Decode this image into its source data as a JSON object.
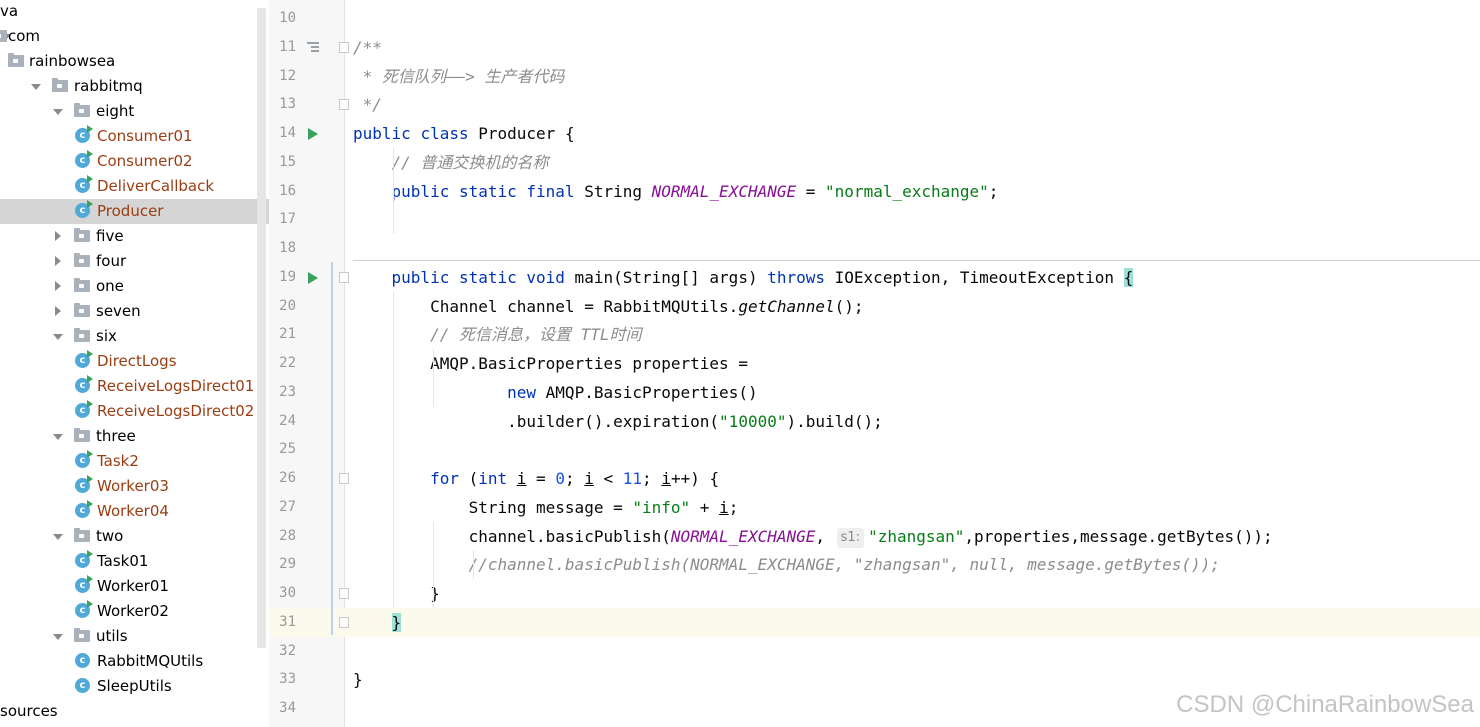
{
  "tree": {
    "items": [
      {
        "label": "va",
        "depth": 0,
        "kind": "text",
        "expanded": null,
        "modified": false
      },
      {
        "label": "com",
        "depth": 0,
        "kind": "package",
        "expanded": true,
        "modified": false
      },
      {
        "label": "rainbowsea",
        "depth": 0,
        "kind": "package",
        "expanded": null,
        "modified": false
      },
      {
        "label": "rabbitmq",
        "depth": 1,
        "kind": "package",
        "expanded": true,
        "modified": false
      },
      {
        "label": "eight",
        "depth": 2,
        "kind": "package",
        "expanded": true,
        "modified": false
      },
      {
        "label": "Consumer01",
        "depth": 3,
        "kind": "class",
        "expanded": null,
        "modified": true
      },
      {
        "label": "Consumer02",
        "depth": 3,
        "kind": "class",
        "expanded": null,
        "modified": true
      },
      {
        "label": "DeliverCallback",
        "depth": 3,
        "kind": "class",
        "expanded": null,
        "modified": true
      },
      {
        "label": "Producer",
        "depth": 3,
        "kind": "class",
        "expanded": null,
        "modified": true,
        "selected": true
      },
      {
        "label": "five",
        "depth": 2,
        "kind": "package",
        "expanded": false,
        "modified": false
      },
      {
        "label": "four",
        "depth": 2,
        "kind": "package",
        "expanded": false,
        "modified": false
      },
      {
        "label": "one",
        "depth": 2,
        "kind": "package",
        "expanded": false,
        "modified": false
      },
      {
        "label": "seven",
        "depth": 2,
        "kind": "package",
        "expanded": false,
        "modified": false
      },
      {
        "label": "six",
        "depth": 2,
        "kind": "package",
        "expanded": true,
        "modified": false
      },
      {
        "label": "DirectLogs",
        "depth": 3,
        "kind": "class",
        "expanded": null,
        "modified": true
      },
      {
        "label": "ReceiveLogsDirect01",
        "depth": 3,
        "kind": "class",
        "expanded": null,
        "modified": true
      },
      {
        "label": "ReceiveLogsDirect02",
        "depth": 3,
        "kind": "class",
        "expanded": null,
        "modified": true
      },
      {
        "label": "three",
        "depth": 2,
        "kind": "package",
        "expanded": true,
        "modified": false
      },
      {
        "label": "Task2",
        "depth": 3,
        "kind": "class",
        "expanded": null,
        "modified": true
      },
      {
        "label": "Worker03",
        "depth": 3,
        "kind": "class",
        "expanded": null,
        "modified": true
      },
      {
        "label": "Worker04",
        "depth": 3,
        "kind": "class",
        "expanded": null,
        "modified": true
      },
      {
        "label": "two",
        "depth": 2,
        "kind": "package",
        "expanded": true,
        "modified": false
      },
      {
        "label": "Task01",
        "depth": 3,
        "kind": "class",
        "expanded": null,
        "modified": false
      },
      {
        "label": "Worker01",
        "depth": 3,
        "kind": "class",
        "expanded": null,
        "modified": false
      },
      {
        "label": "Worker02",
        "depth": 3,
        "kind": "class",
        "expanded": null,
        "modified": false
      },
      {
        "label": "utils",
        "depth": 2,
        "kind": "package",
        "expanded": true,
        "modified": false
      },
      {
        "label": "RabbitMQUtils",
        "depth": 3,
        "kind": "class",
        "expanded": null,
        "modified": false,
        "plain_icon": true
      },
      {
        "label": "SleepUtils",
        "depth": 3,
        "kind": "class",
        "expanded": null,
        "modified": false,
        "plain_icon": true
      },
      {
        "label": "sources",
        "depth": 0,
        "kind": "text",
        "expanded": null,
        "modified": false
      }
    ]
  },
  "editor": {
    "lines": [
      {
        "n": "10",
        "tokens": []
      },
      {
        "n": "11",
        "tokens": [
          [
            "cm",
            "/**"
          ]
        ],
        "gutter": "doc",
        "fold": true
      },
      {
        "n": "12",
        "tokens": [
          [
            "cm",
            " * 死信队列——> 生产者代码"
          ]
        ]
      },
      {
        "n": "13",
        "tokens": [
          [
            "cm",
            " */"
          ]
        ],
        "fold": true
      },
      {
        "n": "14",
        "tokens": [
          [
            "kw",
            "public"
          ],
          [
            "",
            " "
          ],
          [
            "kw",
            "class"
          ],
          [
            "",
            " Producer {"
          ]
        ],
        "gutter": "run"
      },
      {
        "n": "15",
        "tokens": [
          [
            "",
            "    "
          ],
          [
            "cm",
            "// 普通交换机的名称"
          ]
        ]
      },
      {
        "n": "16",
        "tokens": [
          [
            "",
            "    "
          ],
          [
            "kw",
            "public static final"
          ],
          [
            "",
            " String "
          ],
          [
            "fld",
            "NORMAL_EXCHANGE"
          ],
          [
            "",
            " = "
          ],
          [
            "st",
            "\"normal_exchange\""
          ],
          [
            "",
            ";"
          ]
        ]
      },
      {
        "n": "17",
        "tokens": []
      },
      {
        "n": "18",
        "tokens": []
      },
      {
        "n": "19",
        "tokens": [
          [
            "",
            "    "
          ],
          [
            "kw",
            "public static void"
          ],
          [
            "",
            " main(String[] args) "
          ],
          [
            "kw",
            "throws"
          ],
          [
            "",
            " IOException, TimeoutException "
          ],
          [
            "brace-hl",
            "{"
          ]
        ],
        "gutter": "run",
        "fold": true
      },
      {
        "n": "20",
        "tokens": [
          [
            "",
            "        Channel channel = RabbitMQUtils."
          ],
          [
            "mth",
            "getChannel"
          ],
          [
            "",
            "();"
          ]
        ]
      },
      {
        "n": "21",
        "tokens": [
          [
            "",
            "        "
          ],
          [
            "cm",
            "// 死信消息，设置 TTL时间"
          ]
        ]
      },
      {
        "n": "22",
        "tokens": [
          [
            "",
            "        AMQP.BasicProperties properties ="
          ]
        ]
      },
      {
        "n": "23",
        "tokens": [
          [
            "",
            "                "
          ],
          [
            "kw",
            "new"
          ],
          [
            "",
            " AMQP.BasicProperties()"
          ]
        ]
      },
      {
        "n": "24",
        "tokens": [
          [
            "",
            "                .builder().expiration("
          ],
          [
            "st",
            "\"10000\""
          ],
          [
            "",
            ").build();"
          ]
        ]
      },
      {
        "n": "25",
        "tokens": []
      },
      {
        "n": "26",
        "tokens": [
          [
            "",
            "        "
          ],
          [
            "kw",
            "for"
          ],
          [
            "",
            " ("
          ],
          [
            "kw",
            "int"
          ],
          [
            "",
            " "
          ],
          [
            "ul",
            "i"
          ],
          [
            "",
            " = "
          ],
          [
            "num",
            "0"
          ],
          [
            "",
            "; "
          ],
          [
            "ul",
            "i"
          ],
          [
            "",
            " < "
          ],
          [
            "num",
            "11"
          ],
          [
            "",
            "; "
          ],
          [
            "ul",
            "i"
          ],
          [
            "",
            "++) {"
          ]
        ],
        "fold": true
      },
      {
        "n": "27",
        "tokens": [
          [
            "",
            "            String message = "
          ],
          [
            "st",
            "\"info\""
          ],
          [
            "",
            " + "
          ],
          [
            "ul",
            "i"
          ],
          [
            "",
            ";"
          ]
        ]
      },
      {
        "n": "28",
        "tokens": [
          [
            "",
            "            channel.basicPublish("
          ],
          [
            "fld",
            "NORMAL_EXCHANGE"
          ],
          [
            "",
            ", "
          ],
          [
            "hint",
            "s1:"
          ],
          [
            "st",
            "\"zhangsan\""
          ],
          [
            "",
            ",properties,message.getBytes());"
          ]
        ]
      },
      {
        "n": "29",
        "tokens": [
          [
            "",
            "            "
          ],
          [
            "cm",
            "//channel.basicPublish(NORMAL_EXCHANGE, \"zhangsan\", null, message.getBytes());"
          ]
        ]
      },
      {
        "n": "30",
        "tokens": [
          [
            "",
            "        }"
          ]
        ],
        "fold": true
      },
      {
        "n": "31",
        "tokens": [
          [
            "",
            "    "
          ],
          [
            "brace-hl",
            "}"
          ]
        ],
        "current": true,
        "fold": true
      },
      {
        "n": "32",
        "tokens": []
      },
      {
        "n": "33",
        "tokens": [
          [
            "",
            "}"
          ]
        ]
      },
      {
        "n": "34",
        "tokens": []
      }
    ]
  },
  "watermark": "CSDN @ChinaRainbowSea"
}
